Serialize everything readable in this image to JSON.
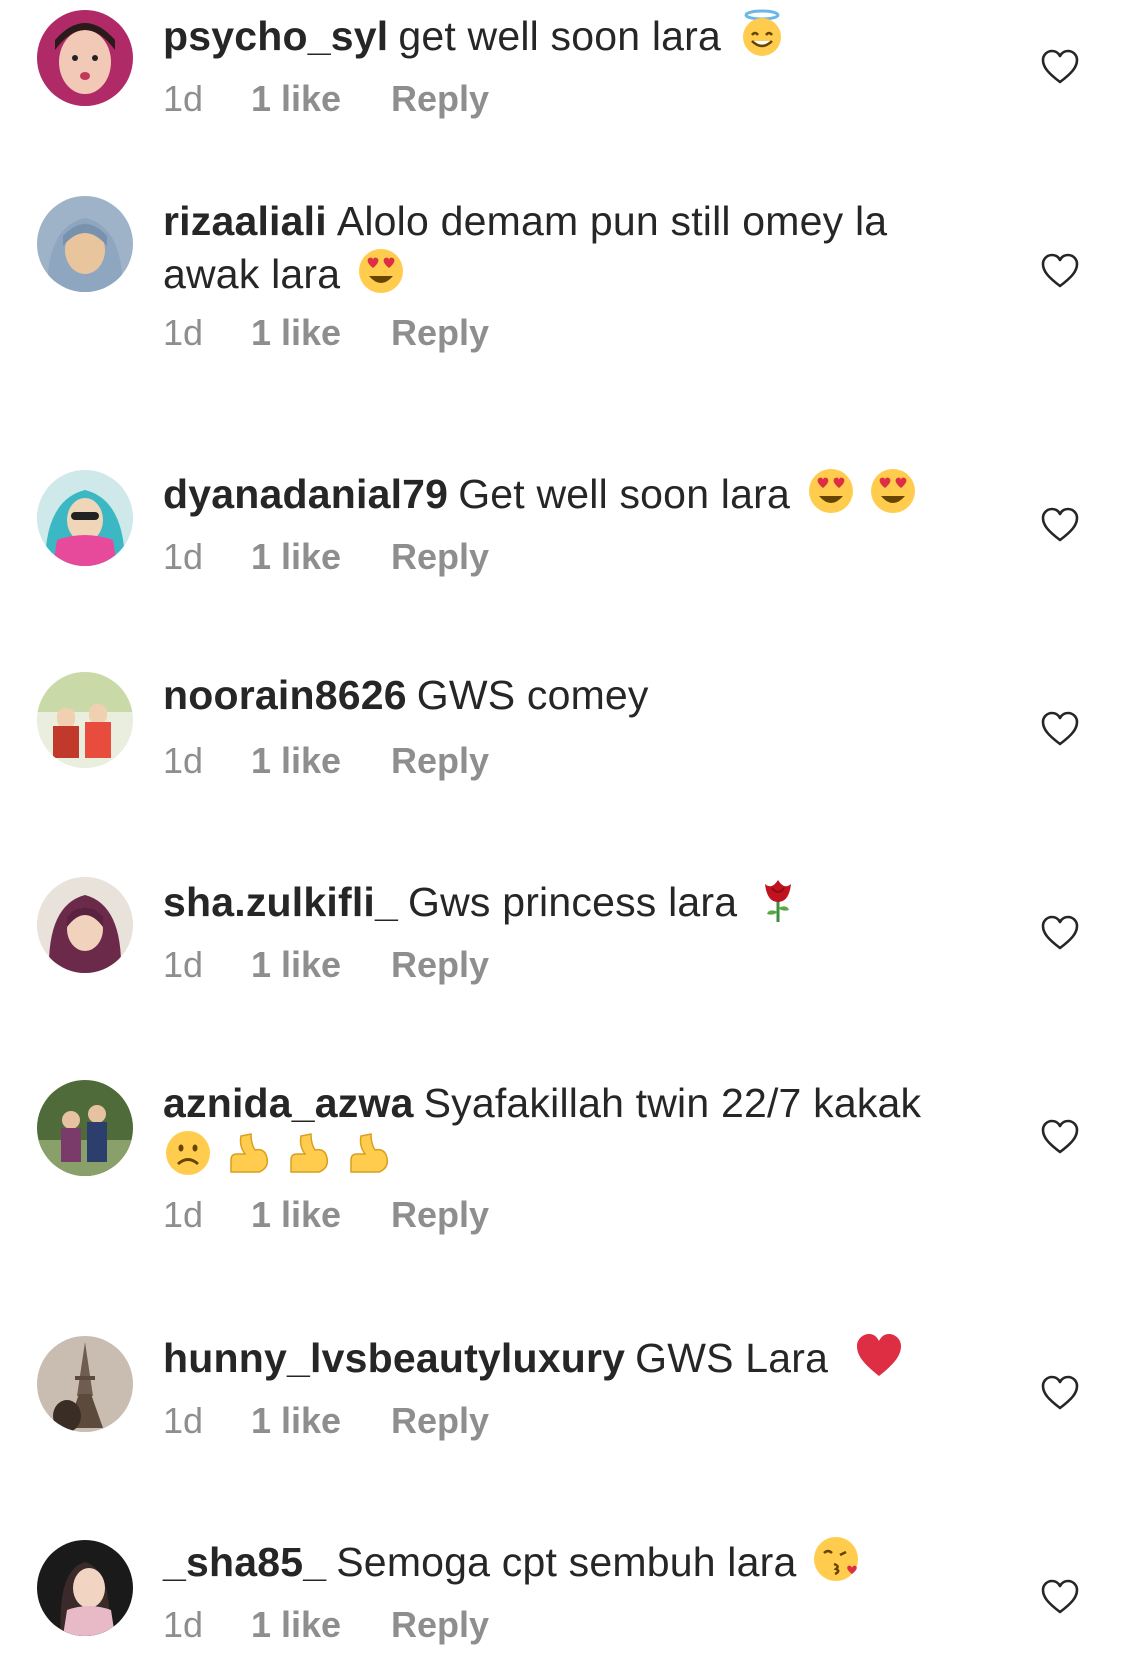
{
  "comments": [
    {
      "username": "psycho_syl",
      "text": "get well soon lara",
      "emojis": [
        "halo-smile"
      ],
      "time": "1d",
      "likes": "1 like",
      "reply": "Reply",
      "avatar_colors": [
        "#b02a68",
        "#f2c9b6"
      ]
    },
    {
      "username": "rizaaliali",
      "text": "Alolo demam pun still omey la awak lara",
      "emojis": [
        "heart-eyes"
      ],
      "time": "1d",
      "likes": "1 like",
      "reply": "Reply",
      "avatar_colors": [
        "#9fb3c8",
        "#e8c59d"
      ]
    },
    {
      "username": "dyanadanial79",
      "text": "Get well soon lara",
      "emojis": [
        "heart-eyes",
        "heart-eyes"
      ],
      "time": "1d",
      "likes": "1 like",
      "reply": "Reply",
      "avatar_colors": [
        "#3bb8c4",
        "#f0d6b8"
      ]
    },
    {
      "username": "noorain8626",
      "text": "GWS comey",
      "emojis": [],
      "time": "1d",
      "likes": "1 like",
      "reply": "Reply",
      "avatar_colors": [
        "#c9d9a8",
        "#c0392b"
      ]
    },
    {
      "username": "sha.zulkifli_",
      "text": "Gws princess lara",
      "emojis": [
        "rose"
      ],
      "time": "1d",
      "likes": "1 like",
      "reply": "Reply",
      "avatar_colors": [
        "#6b2a4a",
        "#f0d2bd"
      ]
    },
    {
      "username": "aznida_azwa",
      "text": "Syafakillah twin 22/7 kakak",
      "emojis": [
        "frown",
        "muscle",
        "muscle",
        "muscle"
      ],
      "time": "1d",
      "likes": "1 like",
      "reply": "Reply",
      "avatar_colors": [
        "#4f6b3a",
        "#2c3e6b"
      ]
    },
    {
      "username": "hunny_lvsbeautyluxury",
      "text": "GWS Lara",
      "emojis": [
        "red-heart"
      ],
      "time": "1d",
      "likes": "1 like",
      "reply": "Reply",
      "avatar_colors": [
        "#b7a89a",
        "#5c4a3d"
      ]
    },
    {
      "username": "_sha85_",
      "text": "Semoga cpt sembuh lara",
      "emojis": [
        "kiss"
      ],
      "time": "1d",
      "likes": "1 like",
      "reply": "Reply",
      "avatar_colors": [
        "#1a1a1a",
        "#e8b9c6"
      ]
    }
  ],
  "colors": {
    "text": "#262626",
    "meta": "#8e8e8e",
    "background": "#ffffff"
  },
  "icons": {
    "like": "heart-outline-icon"
  }
}
